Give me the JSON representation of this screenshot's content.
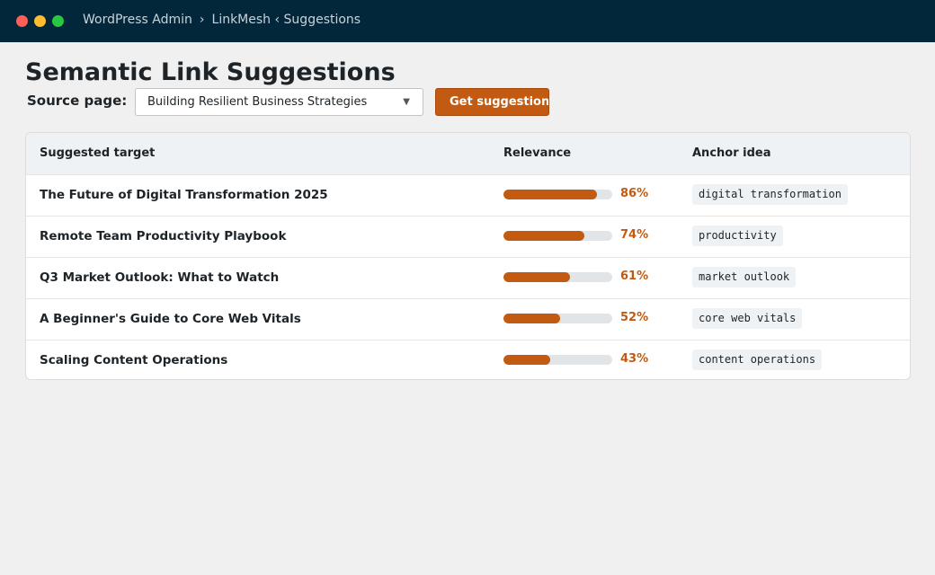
{
  "window": {
    "breadcrumb": [
      "WordPress Admin",
      "LinkMesh ‹ Suggestions"
    ],
    "separator": "›"
  },
  "page": {
    "title": "Semantic Link Suggestions"
  },
  "controls": {
    "source_label": "Source page:",
    "source_value": "Building Resilient Business Strategies",
    "caret": "▼",
    "button_label": "Get suggestions"
  },
  "table": {
    "headers": [
      "Suggested target",
      "Relevance",
      "Anchor idea"
    ],
    "rows": [
      {
        "title": "The Future of Digital Transformation 2025",
        "relevance": 86,
        "pct": "86%",
        "anchor": "digital transformation"
      },
      {
        "title": "Remote Team Productivity Playbook",
        "relevance": 74,
        "pct": "74%",
        "anchor": "productivity"
      },
      {
        "title": "Q3 Market Outlook: What to Watch",
        "relevance": 61,
        "pct": "61%",
        "anchor": "market outlook"
      },
      {
        "title": "A Beginner's Guide to Core Web Vitals",
        "relevance": 52,
        "pct": "52%",
        "anchor": "core web vitals"
      },
      {
        "title": "Scaling Content Operations",
        "relevance": 43,
        "pct": "43%",
        "anchor": "content operations"
      }
    ]
  },
  "colors": {
    "accent": "#c25a12",
    "titlebar": "#02263a",
    "background": "#f0f0f1"
  }
}
